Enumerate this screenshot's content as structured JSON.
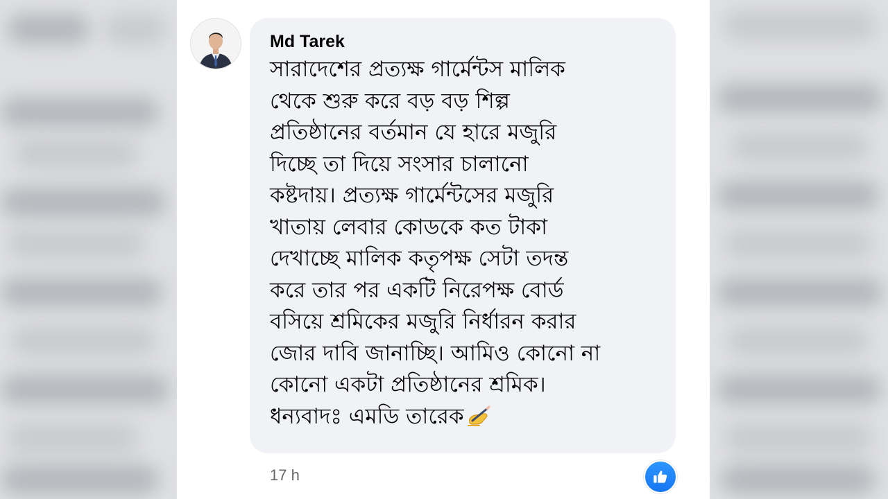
{
  "comment": {
    "author": "Md Tarek",
    "text": "সারাদেশের প্রত্যক্ষ গার্মেন্টস মালিক\nথেকে শুরু করে বড় বড় শিল্প\nপ্রতিষ্ঠানের বর্তমান যে হারে মজুরি\nদিচ্ছে তা দিয়ে সংসার চালানো\nকষ্টদায়। প্রত্যক্ষ গার্মেন্টসের মজুরি\nখাতায় লেবার কোডকে কত টাকা\nদেখাচ্ছে মালিক কতৃপক্ষ সেটা তদন্ত\nকরে তার পর একটি নিরেপক্ষ বোর্ড\nবসিয়ে শ্রমিকের মজুরি নির্ধারন করার\nজোর দাবি জানাচ্ছি। আমিও কোনো না\nকোনো একটা প্রতিষ্ঠানের শ্রমিক।\nধন্যবাদঃ এমডি তারেক",
    "trailing_emoji": "writing-hand-emoji",
    "timestamp": "17 h",
    "reaction_icon": "like-icon"
  },
  "colors": {
    "bubble": "#f0f2f5",
    "author": "#050505",
    "timestamp": "#65676b",
    "like": "#1877f2"
  }
}
